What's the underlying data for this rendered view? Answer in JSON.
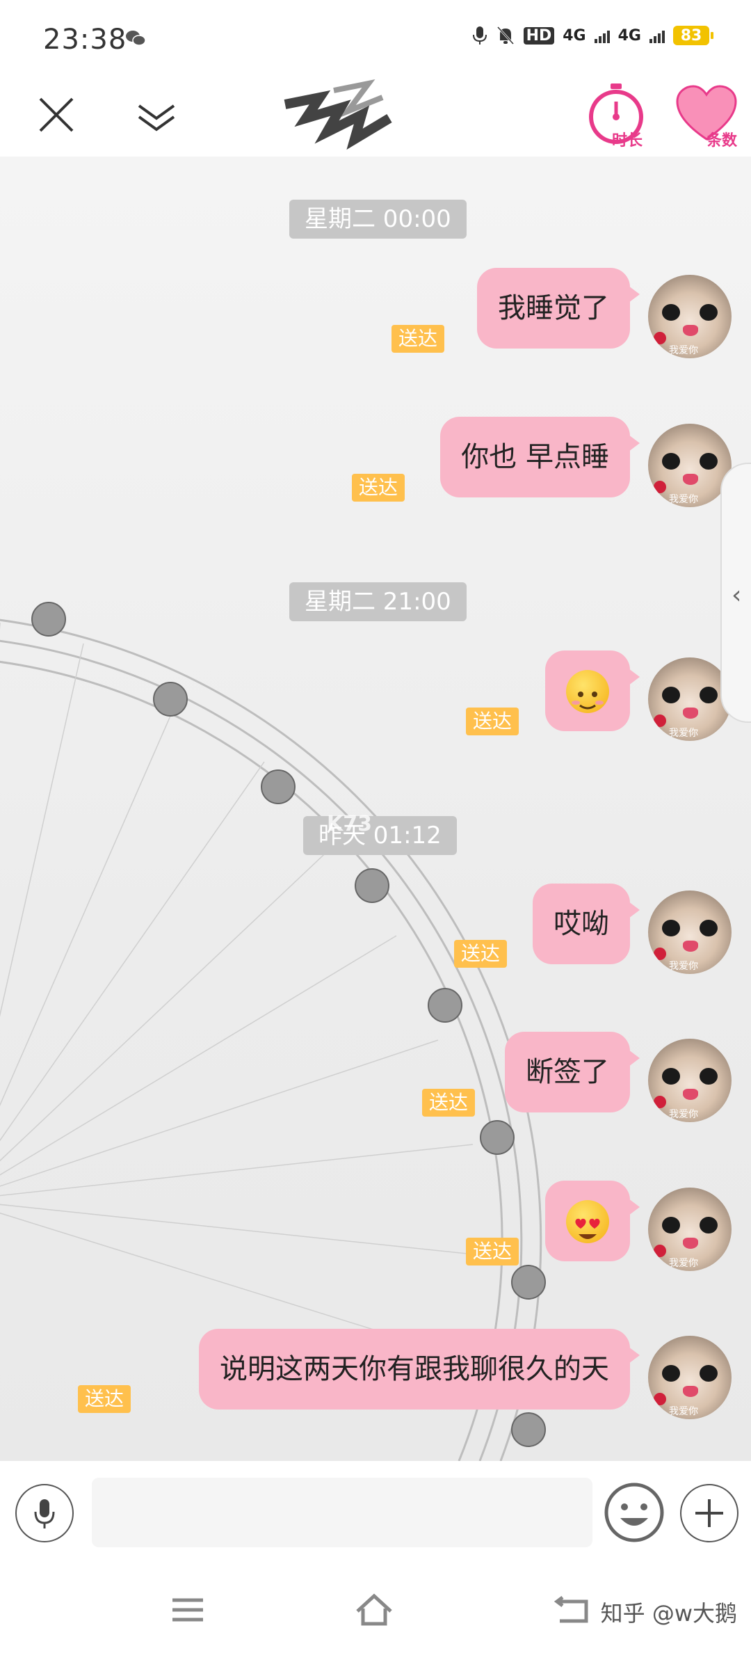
{
  "status_bar": {
    "time": "23:38",
    "network_label_1": "4G",
    "network_label_2": "4G",
    "hd_label": "HD",
    "battery": "83"
  },
  "header": {
    "close_icon": "close-icon",
    "minimize_icon": "chevron-double-down-icon",
    "duration_label": "时长",
    "count_label": "条数"
  },
  "chat": {
    "timestamps": [
      "星期二 00:00",
      "星期二 21:00",
      "昨天 01:12"
    ],
    "delivered_label": "送达",
    "messages": [
      {
        "text": "我睡觉了"
      },
      {
        "text": "你也 早点睡"
      },
      {
        "text": "",
        "emoji": "smiling-face"
      },
      {
        "text": "哎呦"
      },
      {
        "text": "断签了"
      },
      {
        "text": "",
        "emoji": "heart-eyes-face"
      },
      {
        "text": "说明这两天你有跟我聊很久的天"
      }
    ],
    "avatar_caption": "我爱你",
    "watermark_logo": "K73"
  },
  "input_bar": {
    "voice_icon": "microphone-icon",
    "placeholder": "",
    "emoji_icon": "smile-icon",
    "plus_icon": "plus-icon"
  },
  "nav_bar": {
    "menu_icon": "menu-icon",
    "home_icon": "home-icon",
    "back_icon": "back-icon",
    "watermark": "知乎 @w大鹅"
  },
  "colors": {
    "bubble": "#f9b6c8",
    "delivered": "#ffc04d",
    "timestamp": "#c6c6c6",
    "accent_pink": "#e83a8a"
  }
}
